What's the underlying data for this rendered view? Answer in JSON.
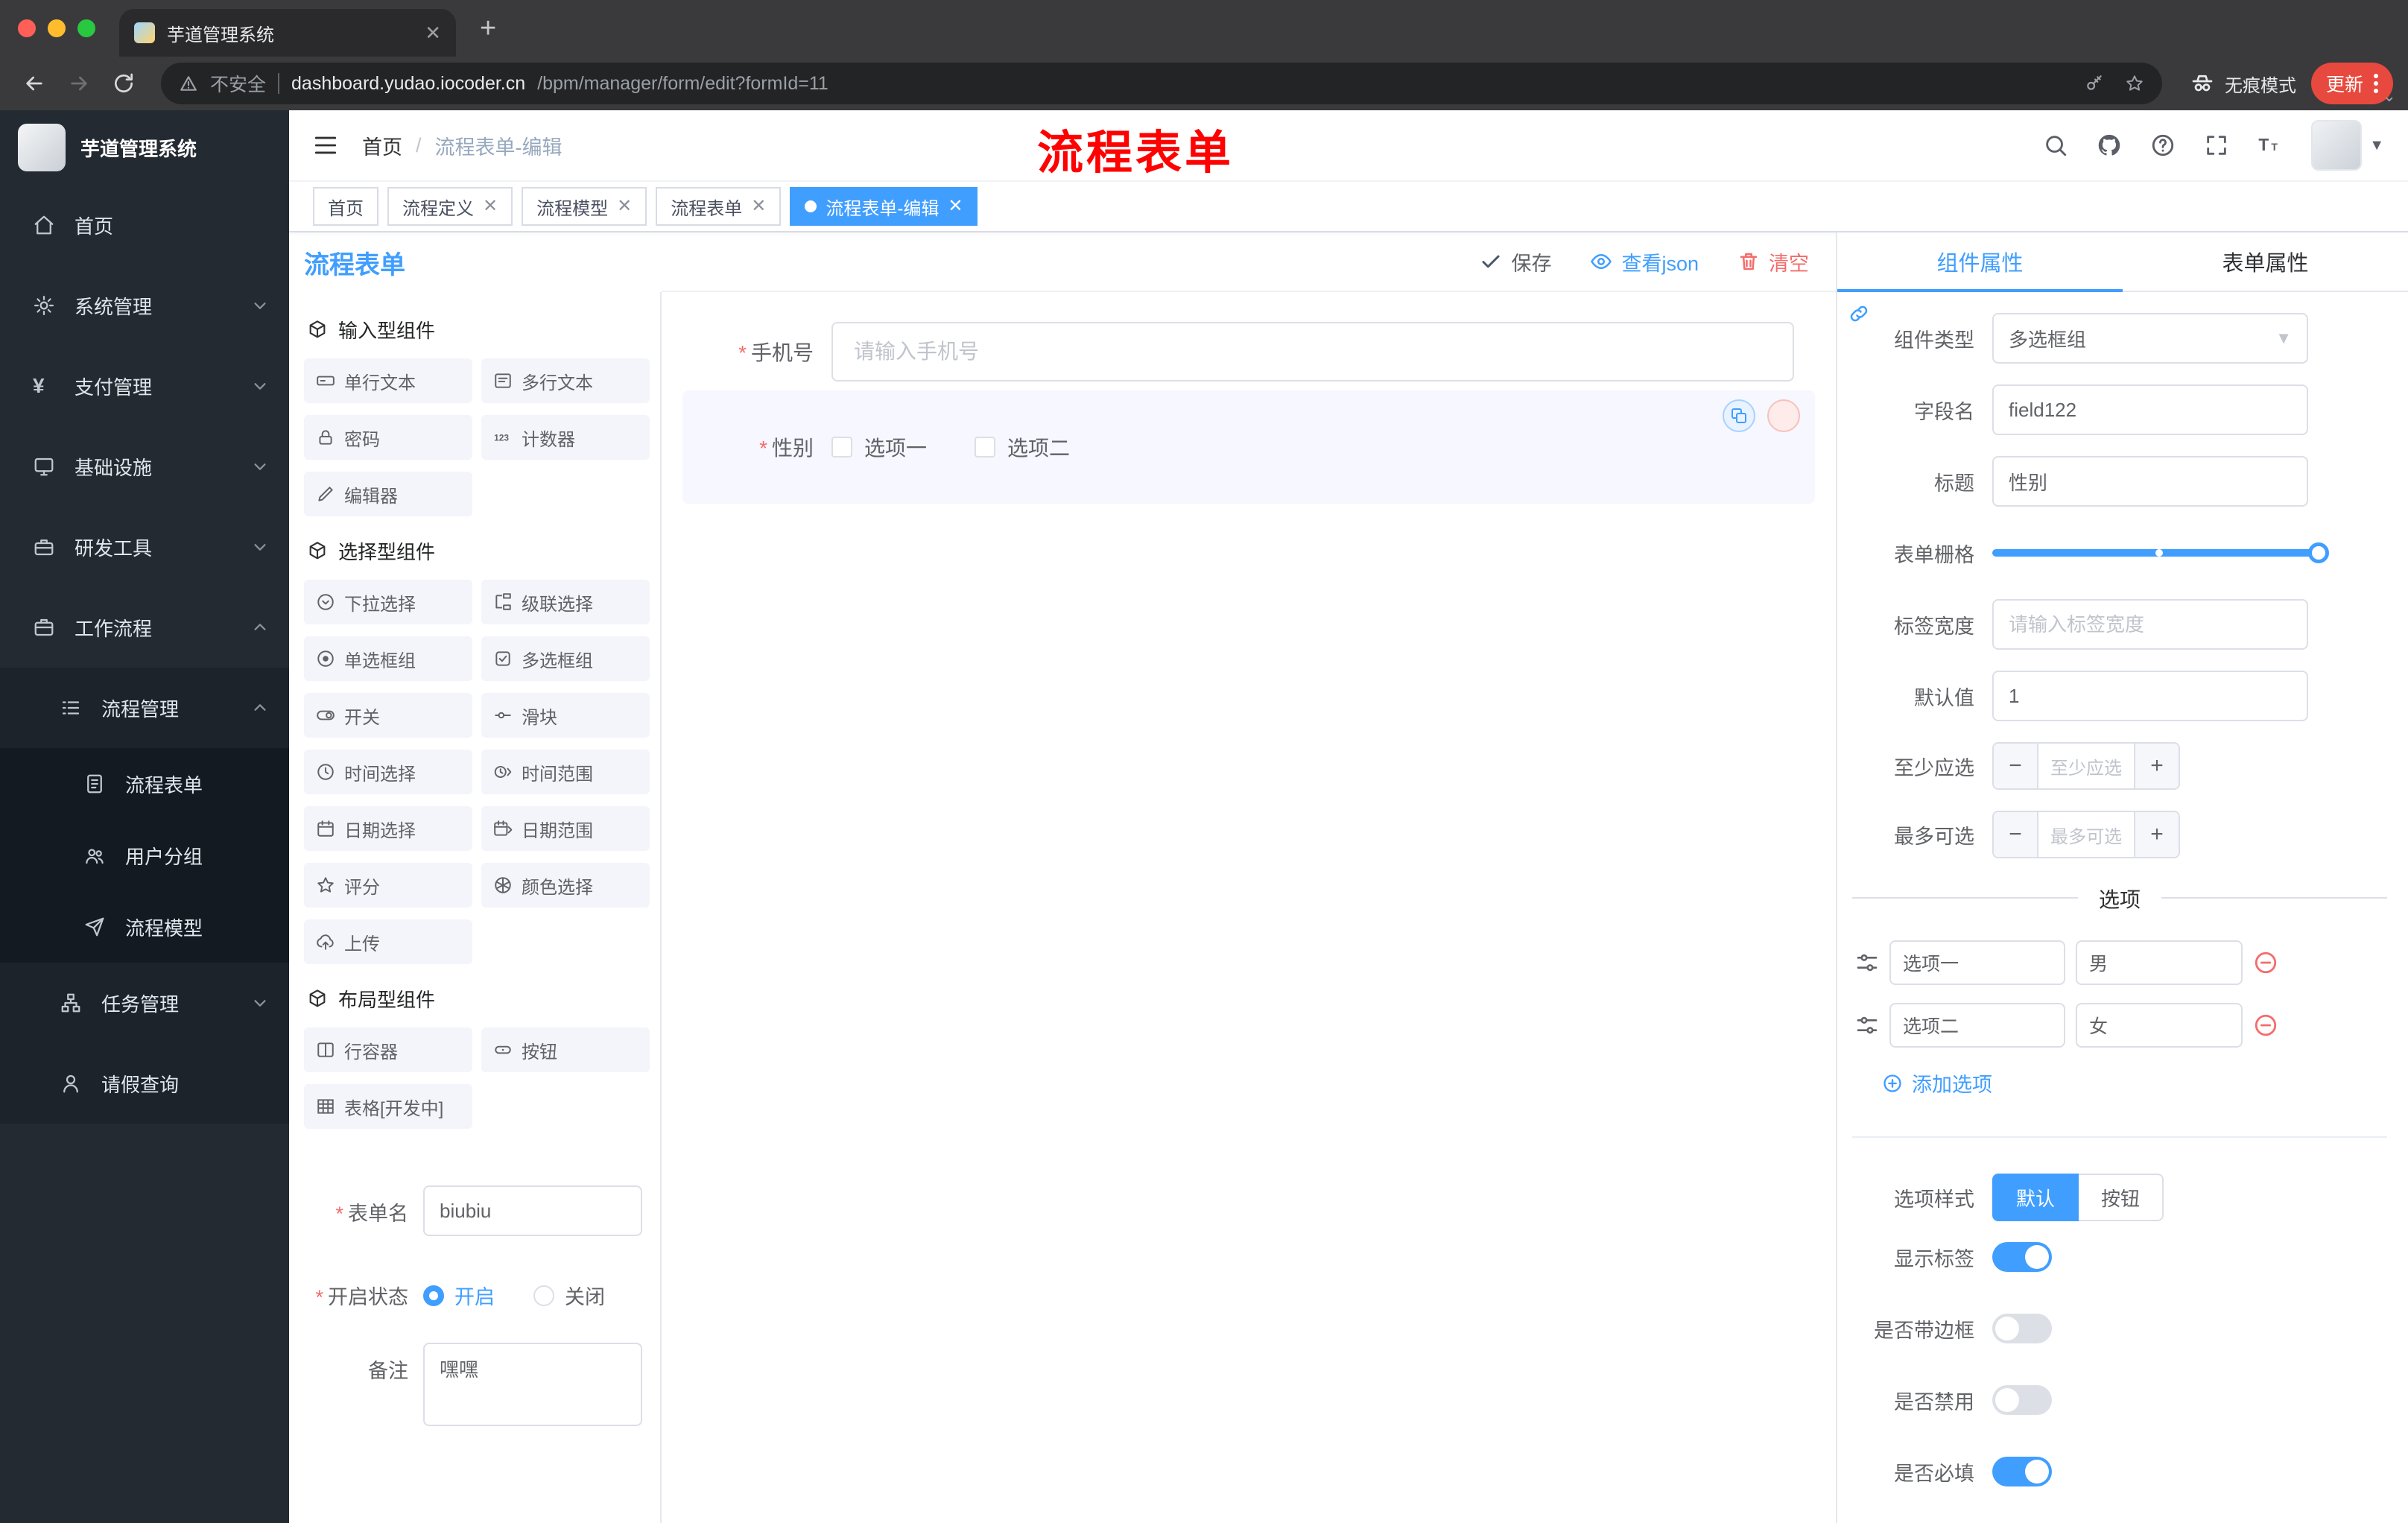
{
  "theme": {
    "accent": "#409eff",
    "danger": "#f56c6c",
    "annotation_red": "#fe0100",
    "sidebar_bg": "#242a31",
    "chrome_bg": "#3a3a3c",
    "selected_field_bg": "#f6f7ff"
  },
  "browser": {
    "tab_title": "芋道管理系统",
    "security_label": "不安全",
    "url_host": "dashboard.yudao.iocoder.cn",
    "url_path": "/bpm/manager/form/edit?formId=11",
    "incognito_label": "无痕模式",
    "update_label": "更新"
  },
  "sidebar": {
    "logo_title": "芋道管理系统",
    "items": [
      {
        "label": "首页"
      },
      {
        "label": "系统管理"
      },
      {
        "label": "支付管理"
      },
      {
        "label": "基础设施"
      },
      {
        "label": "研发工具"
      },
      {
        "label": "工作流程"
      },
      {
        "label": "流程管理"
      },
      {
        "label": "流程表单"
      },
      {
        "label": "用户分组"
      },
      {
        "label": "流程模型"
      },
      {
        "label": "任务管理"
      },
      {
        "label": "请假查询"
      }
    ]
  },
  "header": {
    "breadcrumb_root": "首页",
    "breadcrumb_current": "流程表单-编辑",
    "annotation": "流程表单"
  },
  "tags": [
    {
      "label": "首页"
    },
    {
      "label": "流程定义"
    },
    {
      "label": "流程模型"
    },
    {
      "label": "流程表单"
    },
    {
      "label": "流程表单-编辑"
    }
  ],
  "designer": {
    "title": "流程表单",
    "save": "保存",
    "view_json": "查看json",
    "clear": "清空"
  },
  "palette": {
    "groups": [
      {
        "title": "输入型组件",
        "items": [
          "单行文本",
          "多行文本",
          "密码",
          "计数器",
          "编辑器"
        ]
      },
      {
        "title": "选择型组件",
        "items": [
          "下拉选择",
          "级联选择",
          "单选框组",
          "多选框组",
          "开关",
          "滑块",
          "时间选择",
          "时间范围",
          "日期选择",
          "日期范围",
          "评分",
          "颜色选择",
          "上传"
        ]
      },
      {
        "title": "布局型组件",
        "items": [
          "行容器",
          "按钮",
          "表格[开发中]"
        ]
      }
    ]
  },
  "form_meta": {
    "name_label": "表单名",
    "name_value": "biubiu",
    "status_label": "开启状态",
    "status_on": "开启",
    "status_off": "关闭",
    "status_selected": "开启",
    "remark_label": "备注",
    "remark_value": "嘿嘿"
  },
  "canvas": {
    "phone": {
      "label": "手机号",
      "placeholder": "请输入手机号"
    },
    "gender": {
      "label": "性别",
      "option1": "选项一",
      "option2": "选项二"
    }
  },
  "props": {
    "tab_component": "组件属性",
    "tab_form": "表单属性",
    "component_type_label": "组件类型",
    "component_type_value": "多选框组",
    "field_name_label": "字段名",
    "field_name_value": "field122",
    "title_label": "标题",
    "title_value": "性别",
    "grid_label": "表单栅格",
    "label_width_label": "标签宽度",
    "label_width_placeholder": "请输入标签宽度",
    "default_label": "默认值",
    "default_value": "1",
    "min_label": "至少应选",
    "min_placeholder": "至少应选",
    "max_label": "最多可选",
    "max_placeholder": "最多可选",
    "options_title": "选项",
    "options": [
      {
        "label": "选项一",
        "value": "男"
      },
      {
        "label": "选项二",
        "value": "女"
      }
    ],
    "add_option": "添加选项",
    "style_label": "选项样式",
    "style_default": "默认",
    "style_button": "按钮",
    "style_selected": "默认",
    "toggle_show_label": "显示标签",
    "toggle_border": "是否带边框",
    "toggle_disabled": "是否禁用",
    "toggle_required": "是否必填"
  }
}
